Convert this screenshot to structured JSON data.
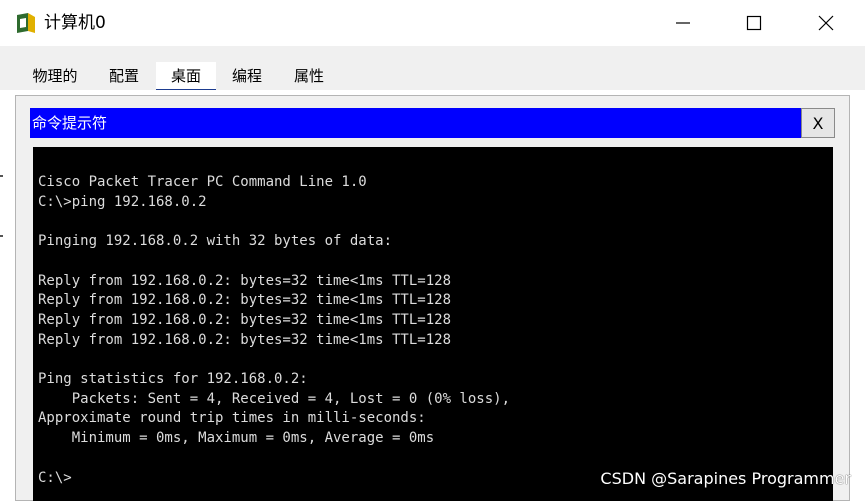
{
  "window": {
    "title": "计算机0",
    "controls": {
      "minimize_icon": "minimize-icon",
      "maximize_icon": "maximize-icon",
      "close_icon": "close-icon"
    }
  },
  "tabs": [
    {
      "label": "物理的",
      "active": false
    },
    {
      "label": "配置",
      "active": false
    },
    {
      "label": "桌面",
      "active": true
    },
    {
      "label": "编程",
      "active": false
    },
    {
      "label": "属性",
      "active": false
    }
  ],
  "command_prompt": {
    "title": "命令提示符",
    "close_label": "X",
    "title_bar_color": "#0000ff",
    "lines": [
      "Cisco Packet Tracer PC Command Line 1.0",
      "C:\\>ping 192.168.0.2",
      "",
      "Pinging 192.168.0.2 with 32 bytes of data:",
      "",
      "Reply from 192.168.0.2: bytes=32 time<1ms TTL=128",
      "Reply from 192.168.0.2: bytes=32 time<1ms TTL=128",
      "Reply from 192.168.0.2: bytes=32 time<1ms TTL=128",
      "Reply from 192.168.0.2: bytes=32 time<1ms TTL=128",
      "",
      "Ping statistics for 192.168.0.2:",
      "    Packets: Sent = 4, Received = 4, Lost = 0 (0% loss),",
      "Approximate round trip times in milli-seconds:",
      "    Minimum = 0ms, Maximum = 0ms, Average = 0ms",
      "",
      "C:\\>"
    ]
  },
  "watermark": "CSDN @Sarapines Programmer"
}
